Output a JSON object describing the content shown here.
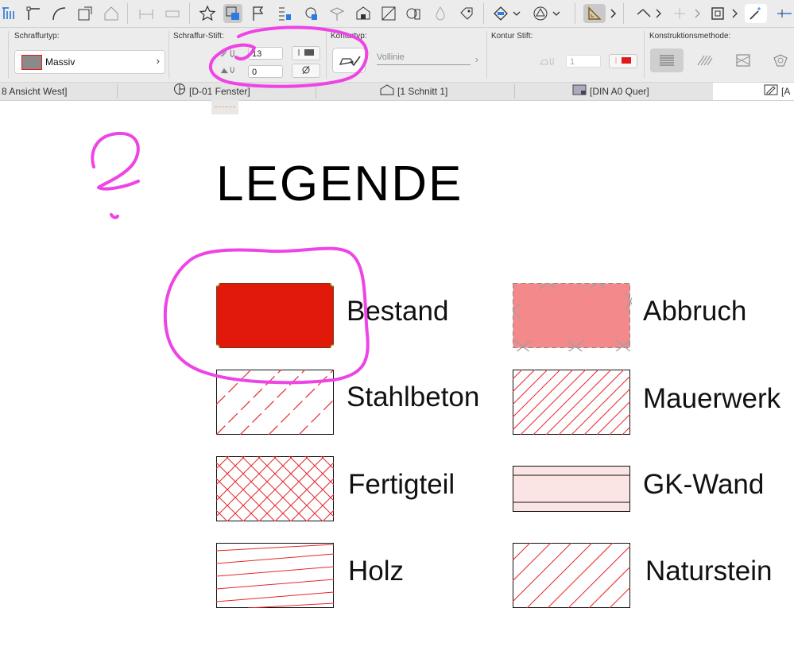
{
  "toolbar": {
    "icons": [
      "dimension-tool-icon",
      "corner-tool-icon",
      "arc-tool-icon",
      "transform-icon",
      "roof-icon",
      "beam-icon",
      "wall-end-icon",
      "favorites-star-icon",
      "fill-tool-icon",
      "flag-icon",
      "layer-list-icon",
      "settings-gear-icon",
      "surface-icon",
      "paint-icon",
      "building-icon",
      "section-icon",
      "label-icon",
      "light-icon",
      "tag-icon",
      "shape-diamond-icon",
      "circle-triangle-icon",
      "ruler-icon",
      "check-mark-icon",
      "plus-icon",
      "transform-box-icon",
      "magic-wand-icon"
    ]
  },
  "infobox": {
    "fill_type_label": "Schraffurtyp:",
    "fill_type_value": "Massiv",
    "fill_pen_label": "Schraffur-Stift:",
    "fill_pen_value": "13",
    "background_pen_value": "0",
    "contour_type_label": "Konturtyp:",
    "line_type_value": "Vollinie",
    "contour_pen_label": "Kontur Stift:",
    "contour_pen_value": "1",
    "method_label": "Konstruktionsmethode:"
  },
  "tabs": [
    {
      "label": "8 Ansicht West]"
    },
    {
      "label": "[D-01 Fenster]"
    },
    {
      "label": "[1 Schnitt 1]"
    },
    {
      "label": "[DIN A0 Quer]"
    },
    {
      "label": "[A"
    }
  ],
  "legend": {
    "title": "LEGENDE",
    "items": [
      {
        "label": "Bestand",
        "pattern": "solid-red"
      },
      {
        "label": "Abbruch",
        "pattern": "solid-pink-crosses"
      },
      {
        "label": "Stahlbeton",
        "pattern": "dashed-diagonal"
      },
      {
        "label": "Mauerwerk",
        "pattern": "dense-diagonal"
      },
      {
        "label": "Fertigteil",
        "pattern": "crosshatch"
      },
      {
        "label": "GK-Wand",
        "pattern": "horizontal-bands"
      },
      {
        "label": "Holz",
        "pattern": "shallow-lines"
      },
      {
        "label": "Naturstein",
        "pattern": "sparse-diagonal"
      }
    ]
  },
  "colors": {
    "accent_red": "#e0191b",
    "hatch_red": "#e8262a",
    "abbruch_pink": "#f4898c",
    "gk_fill": "#fbe4e4",
    "annotation_magenta": "#ee44e6"
  }
}
